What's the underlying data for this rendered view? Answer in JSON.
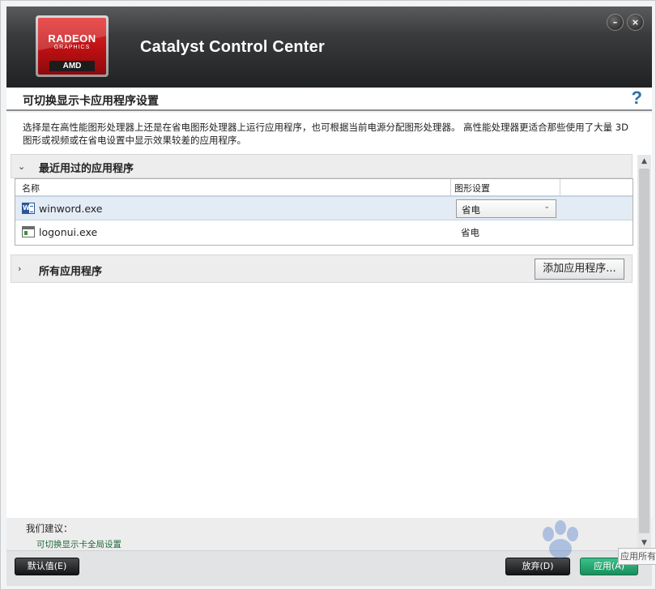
{
  "app": {
    "title": "Catalyst Control Center",
    "logo": {
      "line1": "RADEON",
      "line2": "GRAPHICS",
      "brand": "AMD"
    }
  },
  "window_controls": {
    "minimize_icon": "minimize-icon",
    "close_icon": "close-icon"
  },
  "page": {
    "title": "可切换显示卡应用程序设置",
    "help_icon": "help-icon",
    "description": "选择是在高性能图形处理器上还是在省电图形处理器上运行应用程序，也可根据当前电源分配图形处理器。 高性能处理器更适合那些使用了大量 3D 图形或视频或在省电设置中显示效果较差的应用程序。"
  },
  "recent_section": {
    "title": "最近用过的应用程序",
    "expanded": true,
    "columns": [
      "名称",
      "图形设置"
    ],
    "rows": [
      {
        "name": "winword.exe",
        "icon": "word-doc-icon",
        "setting": "省电",
        "selected": true
      },
      {
        "name": "logonui.exe",
        "icon": "exe-app-icon",
        "setting": "省电",
        "selected": false
      }
    ]
  },
  "all_section": {
    "title": "所有应用程序",
    "expanded": false,
    "add_button": "添加应用程序..."
  },
  "recommendation": {
    "label": "我们建议：",
    "link": "可切换显示卡全局设置"
  },
  "footer": {
    "default_button": "默认值(E)",
    "discard_button": "放弃(D)",
    "apply_button": "应用(A)"
  },
  "tooltip": "应用所有",
  "colors": {
    "header_dark": "#202123",
    "logo_red": "#c41215",
    "help_blue": "#2b6fa6",
    "selected_row": "#e3ebf4",
    "apply_green": "#2aa872",
    "link_green": "#1f6a3a"
  }
}
